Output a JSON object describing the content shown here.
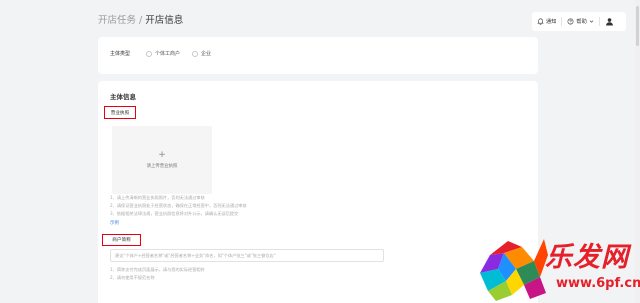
{
  "breadcrumb": {
    "parent": "开店任务",
    "separator": "/",
    "current": "开店信息"
  },
  "topbar": {
    "notify_label": "通知",
    "help_label": "帮助",
    "notify_icon": "bell-icon",
    "help_icon": "question-circle-icon",
    "help_caret_icon": "chevron-down-icon",
    "avatar_icon": "user-avatar-icon"
  },
  "entity_type": {
    "label": "主体类型",
    "options": [
      "个体工商户",
      "企业"
    ]
  },
  "entity_info": {
    "section_title": "主体信息",
    "license_label": "营业执照",
    "upload_hint": "请上传营业执照",
    "notes": [
      "1、请上传清晰的营业执照照片，否则无法通过审核",
      "2、请保证营业执照处于经营状态，确保在正常经营中，否则无法通过审核",
      "3、依据相关法律法规，营业执照信息将对外公示，请确认无误后提交"
    ],
    "example_link": "示例",
    "shop_name_label": "商户简称",
    "shop_name_placeholder": "建议\"个体户+经营者名称\"或\"经营者名称+业务\"命名，如\"个体户张三\"或\"张三餐饮店\"",
    "shop_notes": [
      "1、简称支付完成页面展示，请与您的实际经营相符",
      "2、请勿使用不规范名称"
    ]
  },
  "watermark": {
    "brand": "乐发网",
    "url": "www.6pf.cn"
  },
  "colors": {
    "background": "#f2f3f5",
    "highlight_box": "#e60012",
    "link": "#3a7ee8",
    "watermark": "#e6202a"
  }
}
